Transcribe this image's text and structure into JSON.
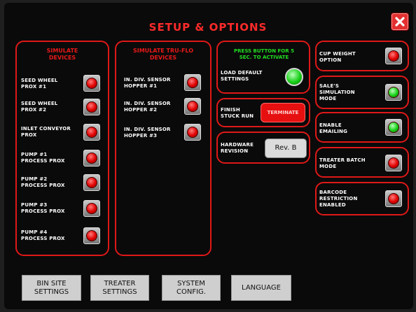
{
  "title": "SETUP & OPTIONS",
  "simulate_devices": {
    "title": "SIMULATE DEVICES",
    "items": [
      {
        "label": "SEED WHEEL PROX #1",
        "state": "red"
      },
      {
        "label": "SEED WHEEL PROX #2",
        "state": "red"
      },
      {
        "label": "INLET CONVEYOR PROX",
        "state": "red"
      },
      {
        "label": "PUMP #1 PROCESS PROX",
        "state": "red"
      },
      {
        "label": "PUMP #2 PROCESS PROX",
        "state": "red"
      },
      {
        "label": "PUMP #3 PROCESS PROX",
        "state": "red"
      },
      {
        "label": "PUMP #4 PROCESS PROX",
        "state": "red"
      }
    ]
  },
  "simulate_truflo": {
    "title": "SIMULATE TRU-FLO DEVICES",
    "items": [
      {
        "label": "IN. DIV. SENSOR HOPPER #1",
        "state": "red"
      },
      {
        "label": "IN. DIV. SENSOR HOPPER #2",
        "state": "red"
      },
      {
        "label": "IN. DIV. SENSOR HOPPER #3",
        "state": "red"
      }
    ]
  },
  "load_default": {
    "hint": "PRESS BUTTON FOR 5 SEC. TO ACTIVATE",
    "label": "LOAD DEFAULT SETTINGS",
    "state": "green"
  },
  "finish_stuck": {
    "label": "FINISH STUCK RUN",
    "button": "TERMINATE"
  },
  "hardware": {
    "label": "HARDWARE REVISION",
    "button": "Rev. B"
  },
  "options": [
    {
      "label": "CUP WEIGHT OPTION",
      "state": "red"
    },
    {
      "label": "SALE'S SIMULATION MODE",
      "state": "green"
    },
    {
      "label": "ENABLE EMAILING",
      "state": "green"
    },
    {
      "label": "TREATER BATCH MODE",
      "state": "red"
    },
    {
      "label": "BARCODE RESTRICTION ENABLED",
      "state": "red"
    }
  ],
  "nav": {
    "bin_site": "BIN SITE SETTINGS",
    "treater": "TREATER SETTINGS",
    "system": "SYSTEM CONFIG.",
    "language": "LANGUAGE"
  },
  "colors": {
    "accent": "#e01818",
    "indicator_on": "#18d018",
    "indicator_off": "#e00000",
    "background": "#0a0a0a"
  }
}
